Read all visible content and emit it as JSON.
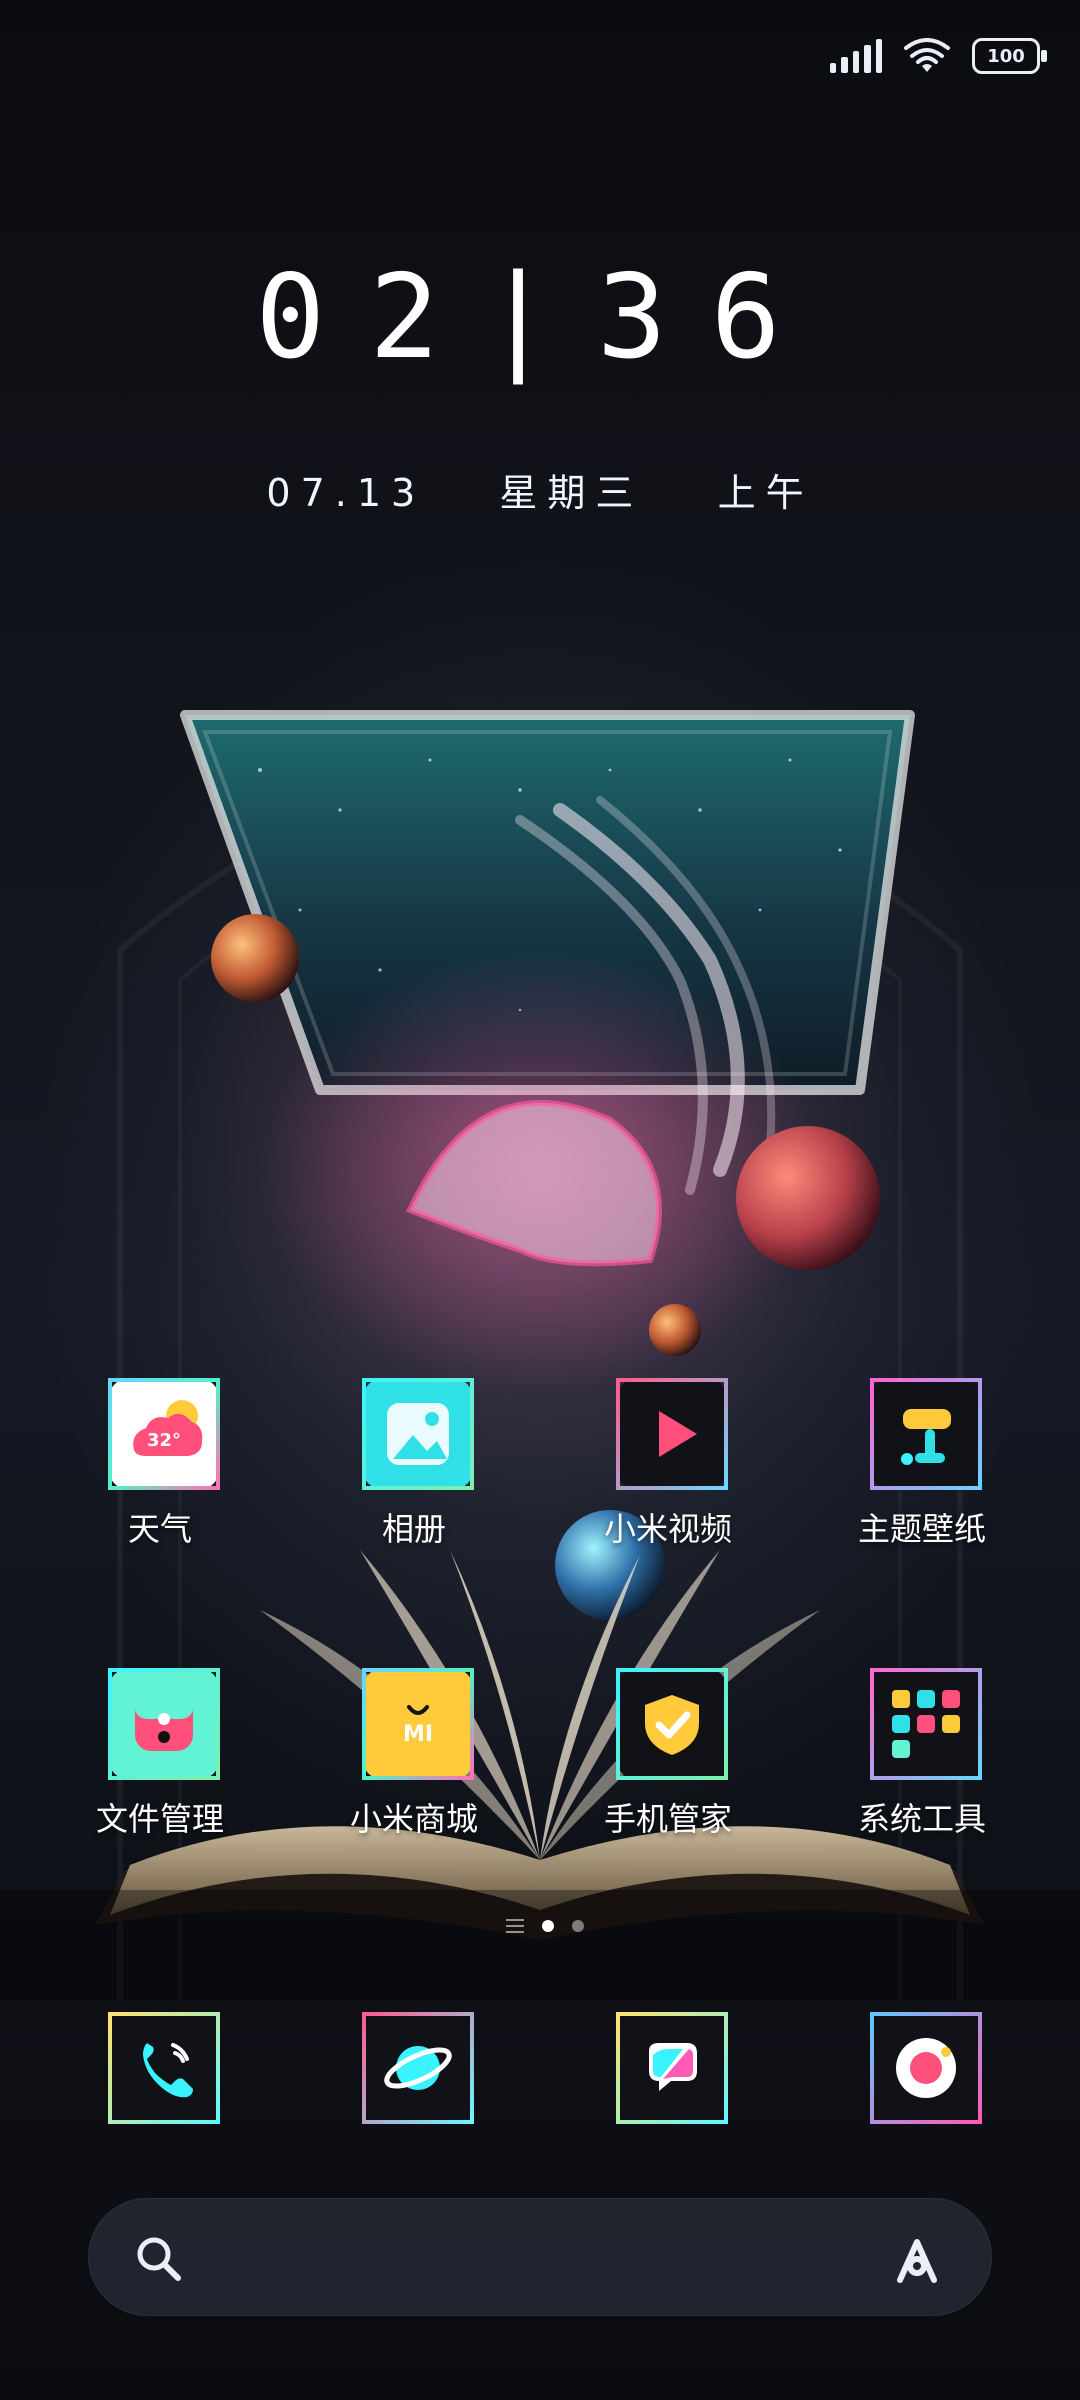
{
  "status_bar": {
    "battery_level": "100",
    "icons": [
      "signal-icon",
      "wifi-icon",
      "battery-icon"
    ]
  },
  "lockscreen": {
    "time": "02|36",
    "date": {
      "md": "07.13",
      "weekday": "星期三",
      "period": "上午"
    }
  },
  "home": {
    "apps_row_1": [
      {
        "label": "天气",
        "icon": "weather-icon",
        "badge": "32°"
      },
      {
        "label": "相册",
        "icon": "gallery-icon"
      },
      {
        "label": "小米视频",
        "icon": "video-icon"
      },
      {
        "label": "主题壁纸",
        "icon": "themes-icon"
      }
    ],
    "apps_row_2": [
      {
        "label": "文件管理",
        "icon": "file-manager-icon"
      },
      {
        "label": "小米商城",
        "icon": "mi-store-icon",
        "badge": "MI"
      },
      {
        "label": "手机管家",
        "icon": "security-icon"
      },
      {
        "label": "系统工具",
        "icon": "system-tools-folder-icon"
      }
    ],
    "pager": {
      "page_count": 2,
      "active_index": 0
    },
    "dock": [
      {
        "icon": "phone-icon"
      },
      {
        "icon": "browser-icon"
      },
      {
        "icon": "messages-icon"
      },
      {
        "icon": "camera-icon"
      }
    ]
  },
  "search": {
    "placeholder": "",
    "icons": [
      "search-icon",
      "assistant-icon"
    ]
  },
  "colors": {
    "accent_cyan": "#57f0ff",
    "accent_pink": "#ff5b8a",
    "accent_yellow": "#ffe36a"
  }
}
